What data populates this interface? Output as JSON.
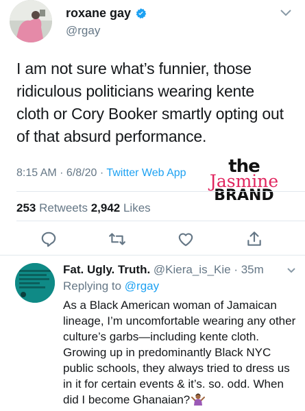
{
  "tweet": {
    "author_name": "roxane gay",
    "author_handle": "@rgay",
    "text": "I am not sure what’s funnier, those ridiculous politicians wearing kente cloth or Cory Booker smartly opting out of that absurd performance.",
    "time": "8:15 AM · 6/8/20 · ",
    "via": "Twitter Web App",
    "retweets_count": "253",
    "retweets_label": " Retweets  ",
    "likes_count": "2,942",
    "likes_label": " Likes"
  },
  "watermark": {
    "line1": "the",
    "line2": "Jasmine",
    "line3": "BRAND"
  },
  "actions": [
    "reply-icon",
    "retweet-icon",
    "like-icon",
    "share-icon"
  ],
  "reply": {
    "author_name": "Fat. Ugly. Truth.",
    "author_handle": " @Kiera_is_Kie · 35m",
    "replying_prefix": "Replying to ",
    "replying_to": "@rgay",
    "text": "As a Black American woman of Jamaican lineage, I’m uncomfortable wearing any other culture’s garbs—including kente cloth. Growing up in predominantly Black NYC public schools, they always tried to dress us in it for certain events & it’s. so. odd. When did I become Ghanaian?",
    "emoji": "woman-shrugging-emoji"
  },
  "colors": {
    "link": "#1da1f2",
    "secondary_text": "#657786",
    "primary_text": "#14171a",
    "watermark_accent": "#e0245e"
  }
}
